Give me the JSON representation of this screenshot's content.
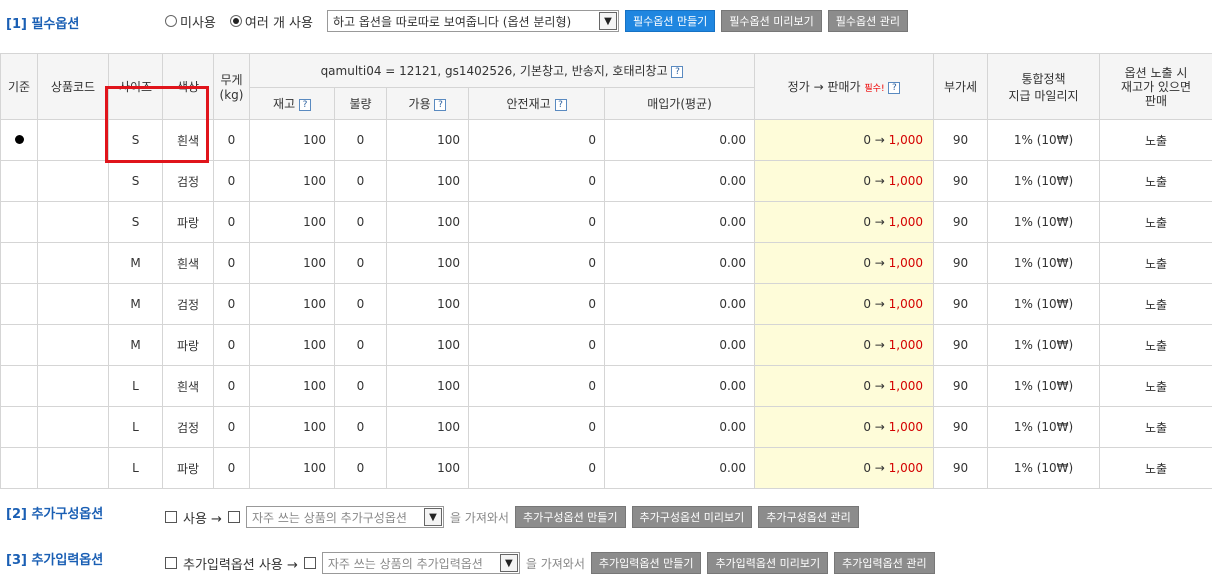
{
  "section1": {
    "title": "[1] 필수옵션",
    "radio_unused": "미사용",
    "radio_multi": "여러 개 사용",
    "display_select": "하고 옵션을 따로따로 보여줍니다 (옵션 분리형)",
    "btn_make": "필수옵션 만들기",
    "btn_preview": "필수옵션 미리보기",
    "btn_manage": "필수옵션 관리"
  },
  "table": {
    "headers": {
      "base": "기준",
      "code": "상품코드",
      "size": "사이즈",
      "color": "색상",
      "weight": "무게\n(kg)",
      "warehouse": "qamulti04 = 12121, gs1402526, 기본창고, 반송지, 호태리창고",
      "stock": "재고",
      "defect": "불량",
      "available": "가용",
      "safety": "안전재고",
      "purchase": "매입가(평균)",
      "price": "정가 → 판매가",
      "required": "필수!",
      "vat": "부가세",
      "mileage": "통합정책\n지급 마일리지",
      "exposure": "옵션 노출 시\n재고가 있으면\n판매"
    },
    "rows": [
      {
        "base": true,
        "size": "S",
        "color": "흰색",
        "weight": "0",
        "stock": "100",
        "defect": "0",
        "available": "100",
        "safety": "0",
        "purchase": "0.00",
        "price_from": "0 →",
        "price_to": "1,000",
        "vat": "90",
        "mileage": "1% (10₩)",
        "exposure": "노출"
      },
      {
        "base": false,
        "size": "S",
        "color": "검정",
        "weight": "0",
        "stock": "100",
        "defect": "0",
        "available": "100",
        "safety": "0",
        "purchase": "0.00",
        "price_from": "0 →",
        "price_to": "1,000",
        "vat": "90",
        "mileage": "1% (10₩)",
        "exposure": "노출"
      },
      {
        "base": false,
        "size": "S",
        "color": "파랑",
        "weight": "0",
        "stock": "100",
        "defect": "0",
        "available": "100",
        "safety": "0",
        "purchase": "0.00",
        "price_from": "0 →",
        "price_to": "1,000",
        "vat": "90",
        "mileage": "1% (10₩)",
        "exposure": "노출"
      },
      {
        "base": false,
        "size": "M",
        "color": "흰색",
        "weight": "0",
        "stock": "100",
        "defect": "0",
        "available": "100",
        "safety": "0",
        "purchase": "0.00",
        "price_from": "0 →",
        "price_to": "1,000",
        "vat": "90",
        "mileage": "1% (10₩)",
        "exposure": "노출"
      },
      {
        "base": false,
        "size": "M",
        "color": "검정",
        "weight": "0",
        "stock": "100",
        "defect": "0",
        "available": "100",
        "safety": "0",
        "purchase": "0.00",
        "price_from": "0 →",
        "price_to": "1,000",
        "vat": "90",
        "mileage": "1% (10₩)",
        "exposure": "노출"
      },
      {
        "base": false,
        "size": "M",
        "color": "파랑",
        "weight": "0",
        "stock": "100",
        "defect": "0",
        "available": "100",
        "safety": "0",
        "purchase": "0.00",
        "price_from": "0 →",
        "price_to": "1,000",
        "vat": "90",
        "mileage": "1% (10₩)",
        "exposure": "노출"
      },
      {
        "base": false,
        "size": "L",
        "color": "흰색",
        "weight": "0",
        "stock": "100",
        "defect": "0",
        "available": "100",
        "safety": "0",
        "purchase": "0.00",
        "price_from": "0 →",
        "price_to": "1,000",
        "vat": "90",
        "mileage": "1% (10₩)",
        "exposure": "노출"
      },
      {
        "base": false,
        "size": "L",
        "color": "검정",
        "weight": "0",
        "stock": "100",
        "defect": "0",
        "available": "100",
        "safety": "0",
        "purchase": "0.00",
        "price_from": "0 →",
        "price_to": "1,000",
        "vat": "90",
        "mileage": "1% (10₩)",
        "exposure": "노출"
      },
      {
        "base": false,
        "size": "L",
        "color": "파랑",
        "weight": "0",
        "stock": "100",
        "defect": "0",
        "available": "100",
        "safety": "0",
        "purchase": "0.00",
        "price_from": "0 →",
        "price_to": "1,000",
        "vat": "90",
        "mileage": "1% (10₩)",
        "exposure": "노출"
      }
    ]
  },
  "section2": {
    "title": "[2] 추가구성옵션",
    "use_label": "사용 →",
    "select": "자주 쓰는 상품의 추가구성옵션",
    "bring": "을 가져와서",
    "btn_make": "추가구성옵션 만들기",
    "btn_preview": "추가구성옵션 미리보기",
    "btn_manage": "추가구성옵션 관리"
  },
  "section3": {
    "title": "[3] 추가입력옵션",
    "use_label": "추가입력옵션 사용 →",
    "select": "자주 쓰는 상품의 추가입력옵션",
    "bring": "을 가져와서",
    "btn_make": "추가입력옵션 만들기",
    "btn_preview": "추가입력옵션 미리보기",
    "btn_manage": "추가입력옵션 관리"
  },
  "colors": {
    "title_blue": "#1a5fb4",
    "button_blue": "#1f86e0",
    "button_gray": "#8c8c8c",
    "price_bg": "#fefcd9",
    "price_red": "#d40000",
    "highlight_red": "#e0141b"
  }
}
